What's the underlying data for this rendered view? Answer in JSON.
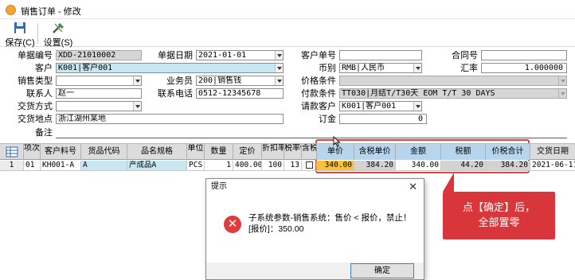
{
  "window": {
    "title": "销售订单 - 修改"
  },
  "toolbar": {
    "save_label": "保存(C)",
    "settings_label": "设置(S)"
  },
  "form": {
    "doc_no": {
      "label": "单据编号",
      "value": "XDD-21010002"
    },
    "doc_date": {
      "label": "单据日期",
      "value": "2021-01-01"
    },
    "cust_doc_no": {
      "label": "客户单号",
      "value": ""
    },
    "contract_no": {
      "label": "合同号",
      "value": ""
    },
    "customer": {
      "label": "客户",
      "value": "K001|客户001"
    },
    "currency": {
      "label": "币别",
      "value": "RMB|人民币"
    },
    "rate": {
      "label": "汇率",
      "value": "1.000000"
    },
    "sales_type": {
      "label": "销售类型",
      "value": ""
    },
    "salesman": {
      "label": "业务员",
      "value": "200|销售钱"
    },
    "price_cond": {
      "label": "价格条件",
      "value": ""
    },
    "contact": {
      "label": "联系人",
      "value": "赵一"
    },
    "phone": {
      "label": "联系电话",
      "value": "0512-12345678"
    },
    "pay_cond": {
      "label": "付款条件",
      "value": "TT030|月结T/T30天 EOM T/T 30 DAYS"
    },
    "delivery_method": {
      "label": "交货方式",
      "value": ""
    },
    "bill_customer": {
      "label": "请款客户",
      "value": "K001|客户001"
    },
    "delivery_place": {
      "label": "交货地点",
      "value": "浙江湖州某地"
    },
    "deposit": {
      "label": "订金",
      "value": "0"
    },
    "remark": {
      "label": "备注",
      "value": ""
    }
  },
  "grid": {
    "headers": {
      "item_no": "项次",
      "cust_part": "客户料号",
      "goods_code": "货品代码",
      "goods_spec": "品名规格",
      "unit": "单位",
      "qty": "数量",
      "price_base": "定价",
      "discount": "折扣率",
      "tax_rate": "税率%",
      "tax_incl": "含税",
      "unit_price": "单价",
      "unit_price_tax": "含税单价",
      "amount": "金额",
      "tax_amount": "税额",
      "total_tax": "价税合计",
      "delivery_date": "交货日期"
    },
    "rows": [
      {
        "row_no": "1",
        "item_no": "01",
        "cust_part": "KH001-A",
        "goods_code": "A",
        "goods_spec": "产成品A",
        "unit": "PCS",
        "qty": "1",
        "price_base": "400.00",
        "discount": "100",
        "tax_rate": "13",
        "tax_incl": "",
        "unit_price": "340.00",
        "unit_price_tax": "384.20",
        "amount": "340.00",
        "tax_amount": "44.20",
        "total_tax": "384.20",
        "delivery_date": "2021-06-11"
      }
    ]
  },
  "dialog": {
    "title": "提示",
    "message_line1": "子系统参数-销售系统：售价 < 报价，禁止！",
    "message_line2": "[报价]：350.00",
    "ok_label": "确定"
  },
  "annotation": {
    "line1": "点【确定】后，",
    "line2": "全部置零",
    "color": "#d9363b"
  }
}
